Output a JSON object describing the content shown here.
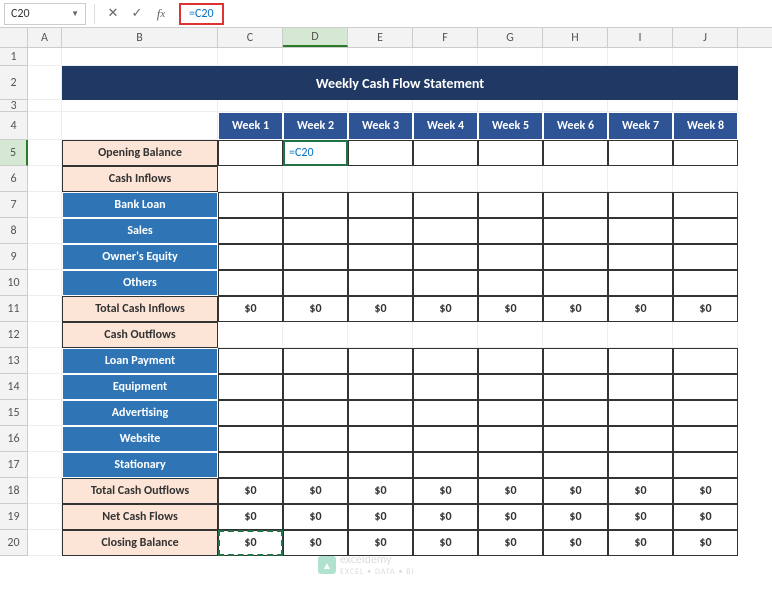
{
  "name_box": "C20",
  "formula": "=C20",
  "title": "Weekly Cash Flow Statement",
  "columns": [
    "A",
    "B",
    "C",
    "D",
    "E",
    "F",
    "G",
    "H",
    "I",
    "J"
  ],
  "row_numbers": [
    "1",
    "2",
    "3",
    "4",
    "5",
    "6",
    "7",
    "8",
    "9",
    "10",
    "11",
    "12",
    "13",
    "14",
    "15",
    "16",
    "17",
    "18",
    "19",
    "20"
  ],
  "weeks": [
    "Week 1",
    "Week 2",
    "Week 3",
    "Week 4",
    "Week 5",
    "Week 6",
    "Week 7",
    "Week 8"
  ],
  "labels": {
    "opening_balance": "Opening Balance",
    "cash_inflows": "Cash Inflows",
    "bank_loan": "Bank Loan",
    "sales": "Sales",
    "owners_equity": "Owner's Equity",
    "others": "Others",
    "total_cash_inflows": "Total Cash Inflows",
    "cash_outflows": "Cash Outflows",
    "loan_payment": "Loan Payment",
    "equipment": "Equipment",
    "advertising": "Advertising",
    "website": "Website",
    "stationary": "Stationary",
    "total_cash_outflows": "Total Cash Outflows",
    "net_cash_flows": "Net Cash Flows",
    "closing_balance": "Closing Balance"
  },
  "active_cell_value": "=C20",
  "zero": "$0",
  "watermark": {
    "brand": "exceldemy",
    "sub": "EXCEL • DATA • BI"
  },
  "chart_data": {
    "type": "table",
    "title": "Weekly Cash Flow Statement",
    "columns": [
      "Week 1",
      "Week 2",
      "Week 3",
      "Week 4",
      "Week 5",
      "Week 6",
      "Week 7",
      "Week 8"
    ],
    "rows": [
      {
        "label": "Opening Balance",
        "values": [
          "",
          "=C20",
          "",
          "",
          "",
          "",
          "",
          ""
        ]
      },
      {
        "label": "Cash Inflows",
        "values": [
          "",
          "",
          "",
          "",
          "",
          "",
          "",
          ""
        ]
      },
      {
        "label": "Bank Loan",
        "values": [
          "",
          "",
          "",
          "",
          "",
          "",
          "",
          ""
        ]
      },
      {
        "label": "Sales",
        "values": [
          "",
          "",
          "",
          "",
          "",
          "",
          "",
          ""
        ]
      },
      {
        "label": "Owner's Equity",
        "values": [
          "",
          "",
          "",
          "",
          "",
          "",
          "",
          ""
        ]
      },
      {
        "label": "Others",
        "values": [
          "",
          "",
          "",
          "",
          "",
          "",
          "",
          ""
        ]
      },
      {
        "label": "Total Cash Inflows",
        "values": [
          "$0",
          "$0",
          "$0",
          "$0",
          "$0",
          "$0",
          "$0",
          "$0"
        ]
      },
      {
        "label": "Cash Outflows",
        "values": [
          "",
          "",
          "",
          "",
          "",
          "",
          "",
          ""
        ]
      },
      {
        "label": "Loan Payment",
        "values": [
          "",
          "",
          "",
          "",
          "",
          "",
          "",
          ""
        ]
      },
      {
        "label": "Equipment",
        "values": [
          "",
          "",
          "",
          "",
          "",
          "",
          "",
          ""
        ]
      },
      {
        "label": "Advertising",
        "values": [
          "",
          "",
          "",
          "",
          "",
          "",
          "",
          ""
        ]
      },
      {
        "label": "Website",
        "values": [
          "",
          "",
          "",
          "",
          "",
          "",
          "",
          ""
        ]
      },
      {
        "label": "Stationary",
        "values": [
          "",
          "",
          "",
          "",
          "",
          "",
          "",
          ""
        ]
      },
      {
        "label": "Total Cash Outflows",
        "values": [
          "$0",
          "$0",
          "$0",
          "$0",
          "$0",
          "$0",
          "$0",
          "$0"
        ]
      },
      {
        "label": "Net Cash Flows",
        "values": [
          "$0",
          "$0",
          "$0",
          "$0",
          "$0",
          "$0",
          "$0",
          "$0"
        ]
      },
      {
        "label": "Closing Balance",
        "values": [
          "$0",
          "$0",
          "$0",
          "$0",
          "$0",
          "$0",
          "$0",
          "$0"
        ]
      }
    ]
  }
}
